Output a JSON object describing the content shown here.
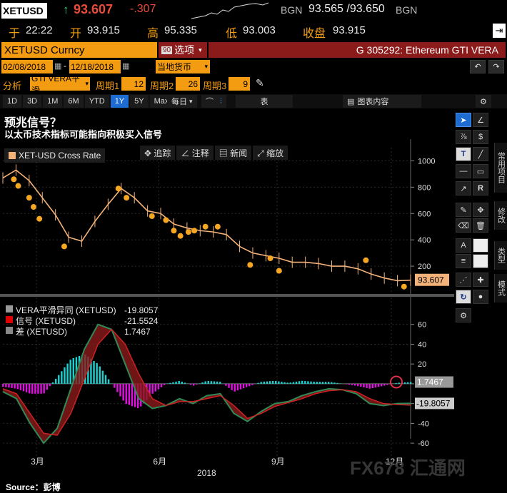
{
  "quote": {
    "ticker": "XETUSD",
    "arrow": "↑",
    "price": "93.607",
    "change": "-.307",
    "bid_src": "BGN",
    "bid_ask": "93.565 /93.650",
    "ask_src": "BGN"
  },
  "stats": {
    "time_label": "于",
    "time": "22:22",
    "open_label": "开",
    "open": "93.915",
    "high_label": "高",
    "high": "95.335",
    "low_label": "低",
    "low": "93.003",
    "close_label": "收盘",
    "close": "93.915"
  },
  "security_bar": {
    "security": "XETUSD Curncy",
    "options_code": "90",
    "options_label": "选项",
    "right_title": "G 305292: Ethereum GTI VERA"
  },
  "date_bar": {
    "start_date": "02/08/2018",
    "end_date": "12/18/2018",
    "currency": "当地货币"
  },
  "analysis_bar": {
    "label": "分析",
    "study": "GTI VERA平滑",
    "period1_label": "周期1",
    "period1": "12",
    "period2_label": "周期2",
    "period2": "26",
    "period3_label": "周期3",
    "period3": "9"
  },
  "range_bar": {
    "ranges": [
      "1D",
      "3D",
      "1M",
      "6M",
      "YTD",
      "1Y",
      "5Y",
      "Max"
    ],
    "active_range": "1Y",
    "freq": "每日",
    "table_label": "表",
    "chart_content_label": "图表内容"
  },
  "heading": {
    "title": "预兆信号？",
    "subtitle": "以太币技术指标可能指向积极买入信号"
  },
  "chart_tools": {
    "legend": "XET-USD Cross Rate",
    "track": "追踪",
    "annotate": "注释",
    "news": "新闻",
    "zoom": "缩放"
  },
  "side_tabs": {
    "common": "常用项目",
    "modify": "修改",
    "type": "类型",
    "style": "模式"
  },
  "indicator_legend": [
    {
      "label": "VERA平滑异同 (XETUSD)",
      "value": "-19.8057",
      "color": "#999999"
    },
    {
      "label": "信号 (XETUSD)",
      "value": "-21.5524",
      "color": "#e00000"
    },
    {
      "label": "差 (XETUSD)",
      "value": "1.7467",
      "color": "#888888"
    }
  ],
  "price_tag": "93.607",
  "macd_tags": {
    "diff": "1.7467",
    "vera": "-19.8057"
  },
  "chart_data": [
    {
      "type": "line",
      "title": "XET-USD Cross Rate",
      "ylim": [
        0,
        1100
      ],
      "yticks": [
        200,
        400,
        600,
        800,
        1000
      ],
      "x": [
        "02/08",
        "02/20",
        "03/01",
        "03/10",
        "03/20",
        "04/01",
        "04/10",
        "04/20",
        "05/01",
        "05/10",
        "05/20",
        "06/01",
        "06/10",
        "06/20",
        "07/01",
        "07/10",
        "07/20",
        "08/01",
        "08/10",
        "08/20",
        "09/01",
        "09/10",
        "09/20",
        "10/01",
        "10/10",
        "10/20",
        "11/01",
        "11/10",
        "11/20",
        "12/01",
        "12/10",
        "12/18"
      ],
      "values": [
        870,
        930,
        850,
        720,
        590,
        420,
        390,
        540,
        670,
        790,
        720,
        620,
        600,
        520,
        490,
        470,
        460,
        440,
        350,
        300,
        280,
        260,
        230,
        230,
        220,
        200,
        200,
        180,
        140,
        110,
        90,
        93.6
      ],
      "signals_x": [
        "02/18",
        "02/22",
        "03/01",
        "03/04",
        "03/08",
        "03/28",
        "05/08",
        "05/14",
        "06/04",
        "06/14",
        "06/20",
        "06/26",
        "07/02",
        "07/06",
        "07/14",
        "07/24",
        "08/18",
        "09/04",
        "09/10",
        "11/16",
        "12/14"
      ],
      "signals_y": [
        860,
        810,
        720,
        650,
        560,
        350,
        790,
        720,
        580,
        550,
        470,
        430,
        460,
        470,
        500,
        500,
        210,
        260,
        165,
        245,
        45
      ]
    },
    {
      "type": "line",
      "title": "VERA平滑异同",
      "ylim": [
        -70,
        80
      ],
      "yticks": [
        60,
        40,
        20,
        0,
        -20,
        -40,
        -60
      ],
      "xlabels": [
        "3月",
        "6月",
        "9月",
        "12月"
      ],
      "year_label": "2018",
      "series": [
        {
          "name": "VERA平滑异同 (XETUSD)",
          "values": [
            -8,
            -15,
            -40,
            -60,
            -45,
            -5,
            35,
            60,
            55,
            20,
            -15,
            -25,
            -22,
            -15,
            -20,
            -12,
            -10,
            -30,
            -38,
            -28,
            -20,
            -18,
            -12,
            -8,
            -5,
            -6,
            -10,
            -20,
            -22,
            -20,
            -19.8
          ]
        },
        {
          "name": "信号 (XETUSD)",
          "values": [
            -5,
            -10,
            -30,
            -50,
            -52,
            -30,
            5,
            40,
            55,
            40,
            10,
            -15,
            -22,
            -18,
            -18,
            -15,
            -12,
            -22,
            -35,
            -30,
            -23,
            -19,
            -15,
            -10,
            -7,
            -6,
            -8,
            -15,
            -20,
            -21,
            -21.6
          ]
        },
        {
          "name": "差 (XETUSD)",
          "values": [
            -3,
            -5,
            -10,
            -10,
            7,
            25,
            30,
            20,
            0,
            -20,
            -25,
            -10,
            0,
            3,
            -2,
            3,
            2,
            -8,
            -3,
            2,
            3,
            1,
            3,
            2,
            2,
            0,
            -2,
            -5,
            -2,
            1,
            1.7
          ]
        }
      ]
    }
  ],
  "footer": {
    "source": "Source：彭博",
    "watermark": "FX678 汇通网"
  }
}
